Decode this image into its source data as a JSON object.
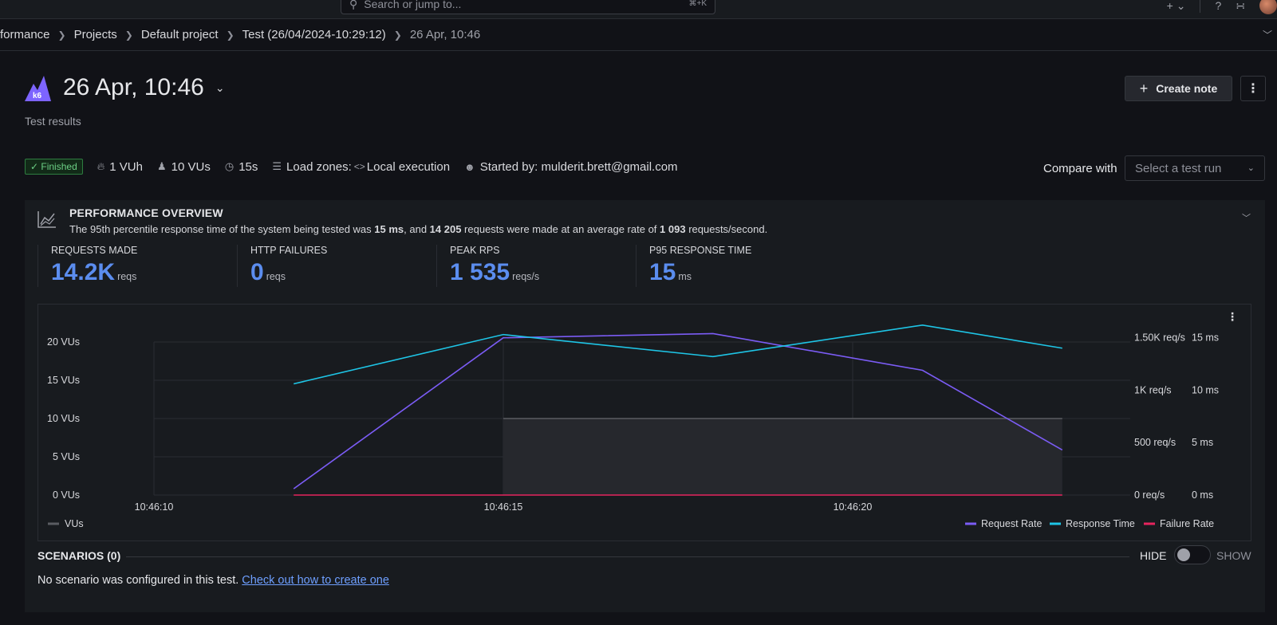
{
  "topbar": {
    "search_placeholder": "Search or jump to...",
    "search_shortcut": "⌘+K"
  },
  "breadcrumb": [
    "formance",
    "Projects",
    "Default project",
    "Test (26/04/2024-10:29:12)"
  ],
  "breadcrumb_current": "26 Apr, 10:46",
  "header": {
    "title": "26 Apr, 10:46",
    "subtitle": "Test results",
    "create_note": "Create note"
  },
  "meta": {
    "status": "Finished",
    "vuh": "1 VUh",
    "vus": "10 VUs",
    "duration": "15s",
    "load_zones": "Load zones:",
    "load_zones_value": "Local execution",
    "started_by": "Started by: mulderit.brett@gmail.com"
  },
  "compare": {
    "label": "Compare with",
    "placeholder": "Select a test run"
  },
  "overview": {
    "title": "PERFORMANCE OVERVIEW",
    "desc_1": "The 95th percentile response time of the system being tested was ",
    "desc_p95": "15 ms",
    "desc_2": ", and ",
    "desc_requests": "14 205",
    "desc_3": " requests were made at an average rate of ",
    "desc_rate": "1 093",
    "desc_4": " requests/second."
  },
  "stats": [
    {
      "label": "REQUESTS MADE",
      "value": "14.2K",
      "unit": "reqs"
    },
    {
      "label": "HTTP FAILURES",
      "value": "0",
      "unit": "reqs"
    },
    {
      "label": "PEAK RPS",
      "value": "1 535",
      "unit": "reqs/s"
    },
    {
      "label": "P95 RESPONSE TIME",
      "value": "15",
      "unit": "ms"
    }
  ],
  "chart_data": {
    "type": "line",
    "x": [
      "10:46:10",
      "10:46:15",
      "10:46:20"
    ],
    "axes": {
      "vus_ticks": [
        "0 VUs",
        "5 VUs",
        "10 VUs",
        "15 VUs",
        "20 VUs"
      ],
      "rps_ticks": [
        "0 req/s",
        "500 req/s",
        "1K req/s",
        "1.50K req/s"
      ],
      "ms_ticks": [
        "0 ms",
        "5 ms",
        "10 ms",
        "15 ms"
      ]
    },
    "ylim_vus": [
      0,
      20
    ],
    "ylim_rps": [
      0,
      1650
    ],
    "ylim_ms": [
      0,
      15.5
    ],
    "x_seconds_labels": [
      10,
      15,
      20
    ],
    "series": [
      {
        "name": "VUs",
        "color": "#5a5c62",
        "x": [
          15,
          20,
          23
        ],
        "values": [
          10,
          10,
          10
        ]
      },
      {
        "name": "Request Rate",
        "color": "#7b5cf5",
        "x": [
          12,
          15,
          18,
          21,
          23
        ],
        "values": [
          60,
          1500,
          1540,
          1190,
          430
        ]
      },
      {
        "name": "Response Time",
        "color": "#1ec5e6",
        "x": [
          12,
          15,
          18,
          21,
          23
        ],
        "values": [
          10.6,
          15.3,
          13.2,
          16.2,
          14.0
        ]
      },
      {
        "name": "Failure Rate",
        "color": "#e6245e",
        "x": [
          12,
          15,
          18,
          21,
          23
        ],
        "values": [
          0,
          0,
          0,
          0,
          0
        ]
      }
    ]
  },
  "scenarios": {
    "title": "SCENARIOS (0)",
    "hide": "HIDE",
    "show": "SHOW",
    "text": "No scenario was configured in this test. ",
    "link": "Check out how to create one"
  }
}
